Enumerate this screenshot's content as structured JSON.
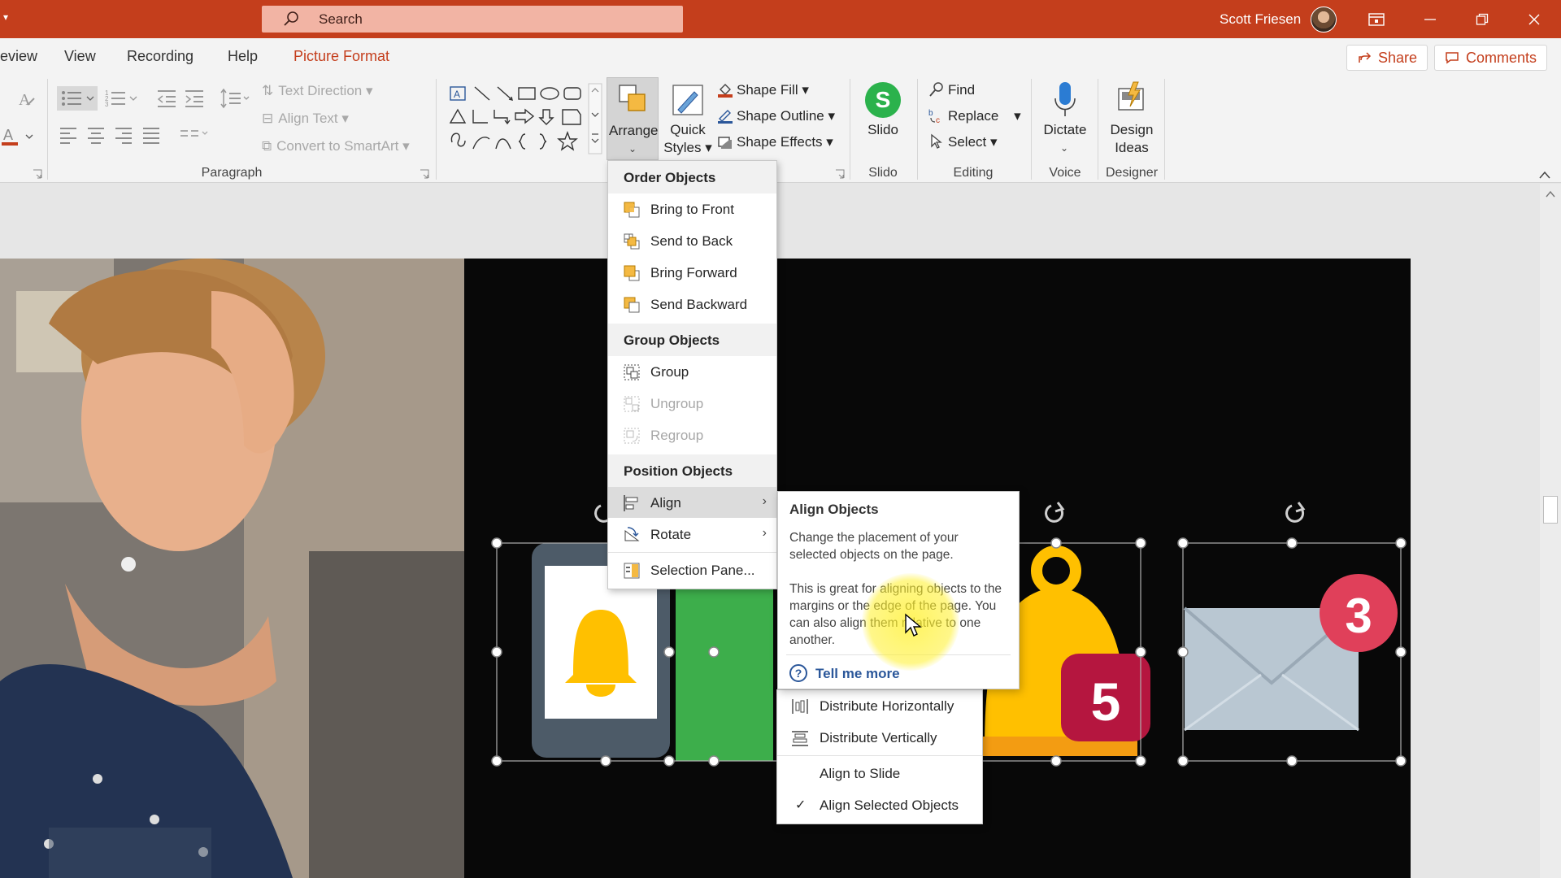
{
  "title_bar": {
    "search_placeholder": "Search",
    "user_name": "Scott Friesen"
  },
  "tabs": [
    "eview",
    "View",
    "Recording",
    "Help",
    "Picture Format"
  ],
  "header_buttons": {
    "share": "Share",
    "comments": "Comments"
  },
  "ribbon": {
    "paragraph": {
      "text_direction": "Text Direction",
      "align_text": "Align Text",
      "convert_smartart": "Convert to SmartArt",
      "label": "Paragraph"
    },
    "arrange": {
      "line1": "Arrange"
    },
    "quick_styles": {
      "line1": "Quick",
      "line2": "Styles"
    },
    "shape_fill": "Shape Fill",
    "shape_outline": "Shape Outline",
    "shape_effects": "Shape Effects",
    "slido": {
      "button": "Slido",
      "label": "Slido"
    },
    "editing": {
      "find": "Find",
      "replace": "Replace",
      "select": "Select",
      "label": "Editing"
    },
    "voice": {
      "dictate": "Dictate",
      "label": "Voice"
    },
    "designer": {
      "line1": "Design",
      "line2": "Ideas",
      "label": "Designer"
    }
  },
  "arrange_menu": {
    "order_header": "Order Objects",
    "order_items": [
      "Bring to Front",
      "Send to Back",
      "Bring Forward",
      "Send Backward"
    ],
    "group_header": "Group Objects",
    "group_items": [
      "Group",
      "Ungroup",
      "Regroup"
    ],
    "position_header": "Position Objects",
    "position_items": [
      "Align",
      "Rotate",
      "Selection Pane..."
    ]
  },
  "tooltip": {
    "title": "Align Objects",
    "para1": "Change the placement of your selected objects on the page.",
    "para2": "This is great for aligning objects to the margins or the edge of the page. You can also align them relative to one another.",
    "link": "Tell me more"
  },
  "align_submenu": {
    "items": [
      "Distribute Horizontally",
      "Distribute Vertically",
      "Align to Slide",
      "Align Selected Objects"
    ]
  },
  "slide": {
    "badge_5": "5",
    "badge_3": "3"
  },
  "colors": {
    "title_bar": "#c43e1c",
    "accent": "#c43e1c",
    "slido_green": "#2bb24c",
    "bell_yellow": "#ffc000",
    "badge_red": "#e0405a",
    "badge_crimson": "#b5163f"
  }
}
